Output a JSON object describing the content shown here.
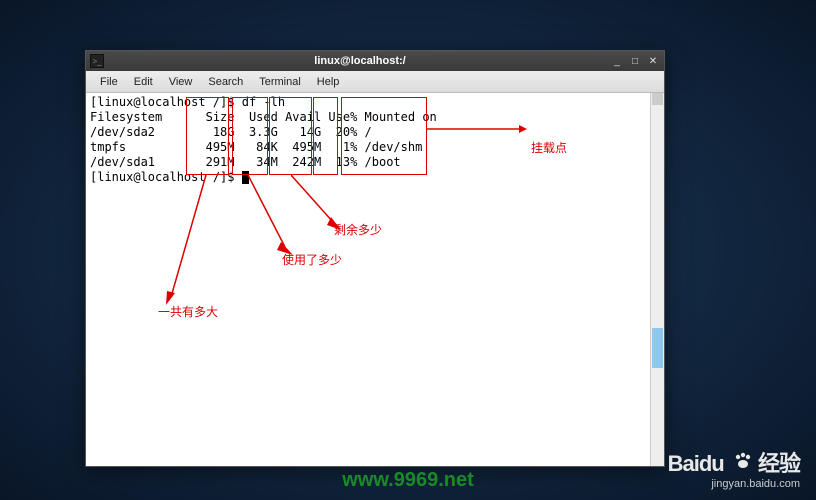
{
  "title": "linux@localhost:/",
  "menu": {
    "file": "File",
    "edit": "Edit",
    "view": "View",
    "search": "Search",
    "terminal": "Terminal",
    "help": "Help"
  },
  "prompt1": "[linux@localhost /]$ df -lh",
  "header": "Filesystem      Size  Used Avail Use% Mounted on",
  "rows": [
    "/dev/sda2        18G  3.3G   14G  20% /",
    "tmpfs           495M   84K  495M   1% /dev/shm",
    "/dev/sda1       291M   34M  242M  13% /boot"
  ],
  "prompt2": "[linux@localhost /]$ ",
  "annotations": {
    "mount": "挂载点",
    "avail": "剩余多少",
    "used": "使用了多少",
    "size": "一共有多大"
  },
  "watermark": {
    "url": "www.9969.net",
    "logo": "Baidu",
    "jingyan": "经验",
    "sub": "jingyan.baidu.com"
  },
  "win": {
    "min": "_",
    "max": "□",
    "close": "✕"
  }
}
